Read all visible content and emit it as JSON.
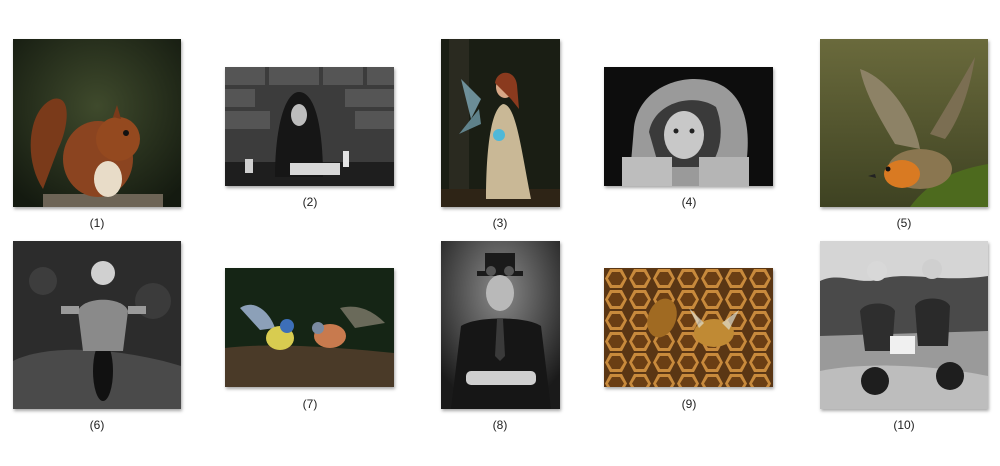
{
  "gallery": {
    "items": [
      {
        "caption": "(1)",
        "subject": "red squirrel eating"
      },
      {
        "caption": "(2)",
        "subject": "hooded monk writing by candlelight"
      },
      {
        "caption": "(3)",
        "subject": "fairy holding glowing orb in forest"
      },
      {
        "caption": "(4)",
        "subject": "girl in bonnet resting chin on hands"
      },
      {
        "caption": "(5)",
        "subject": "robin taking flight from mossy branch"
      },
      {
        "caption": "(6)",
        "subject": "motocross rider through mud"
      },
      {
        "caption": "(7)",
        "subject": "blue tit and chaffinch on log"
      },
      {
        "caption": "(8)",
        "subject": "man in top hat with goggles"
      },
      {
        "caption": "(9)",
        "subject": "honey bees on honeycomb"
      },
      {
        "caption": "(10)",
        "subject": "sidecar motocross team"
      }
    ]
  }
}
